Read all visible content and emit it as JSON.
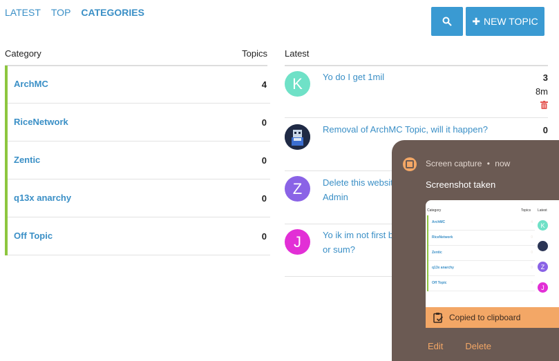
{
  "nav": {
    "latest": "LATEST",
    "top": "TOP",
    "categories": "CATEGORIES"
  },
  "buttons": {
    "search_icon": "search-icon",
    "new_topic": "NEW TOPIC",
    "plus": "✚"
  },
  "categories": {
    "header_name": "Category",
    "header_count": "Topics",
    "accent_color": "#8dc63f",
    "items": [
      {
        "name": "ArchMC",
        "count": "4"
      },
      {
        "name": "RiceNetwork",
        "count": "0"
      },
      {
        "name": "Zentic",
        "count": "0"
      },
      {
        "name": "q13x anarchy",
        "count": "0"
      },
      {
        "name": "Off Topic",
        "count": "0"
      }
    ]
  },
  "latest": {
    "header": "Latest",
    "topics": [
      {
        "avatar": "K",
        "color": "#6fe1c7",
        "title": "Yo do I get 1mil",
        "count": "3",
        "age": "8m"
      },
      {
        "avatar": "",
        "color": "#2b3555",
        "title": "Removal of ArchMC Topic, will it happen?",
        "count": "0",
        "age": ""
      },
      {
        "avatar": "Z",
        "color": "#8a63e6",
        "title": "Delete this website",
        "title2": "Admin",
        "count": "",
        "age": ""
      },
      {
        "avatar": "J",
        "color": "#e22fd6",
        "title": "Yo ik im not first b",
        "title2": "or sum?",
        "count": "",
        "age": ""
      }
    ]
  },
  "notification": {
    "app": "Screen capture",
    "dot": "•",
    "time": "now",
    "title": "Screenshot taken",
    "copied": "Copied to clipboard",
    "edit": "Edit",
    "delete": "Delete",
    "thumb": {
      "header_name": "Category",
      "header_count": "Topics",
      "header_latest": "Latest",
      "rows": [
        {
          "name": "ArchMC",
          "count": "4"
        },
        {
          "name": "RiceNetwork",
          "count": "0"
        },
        {
          "name": "Zentic",
          "count": "0"
        },
        {
          "name": "q13x anarchy",
          "count": "0"
        },
        {
          "name": "Off Topic",
          "count": "0"
        }
      ]
    }
  }
}
